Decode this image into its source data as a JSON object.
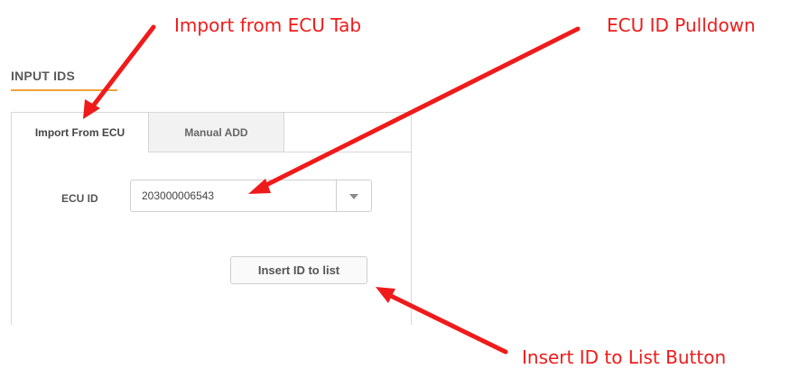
{
  "section_title": "INPUT IDS",
  "tabs": [
    {
      "label": "Import From ECU",
      "active": true
    },
    {
      "label": "Manual ADD",
      "active": false
    }
  ],
  "ecu": {
    "label": "ECU ID",
    "selected_value": "203000006543"
  },
  "insert_button": {
    "label": "Insert ID to list"
  },
  "annotations": {
    "tab": "Import from ECU Tab",
    "pulldown": "ECU ID Pulldown",
    "button": "Insert ID to List Button"
  },
  "colors": {
    "accent_underline": "#f0a23a",
    "annotation_red": "#ef1b1b"
  },
  "icons": {
    "select_toggle": "caret-down-icon"
  }
}
